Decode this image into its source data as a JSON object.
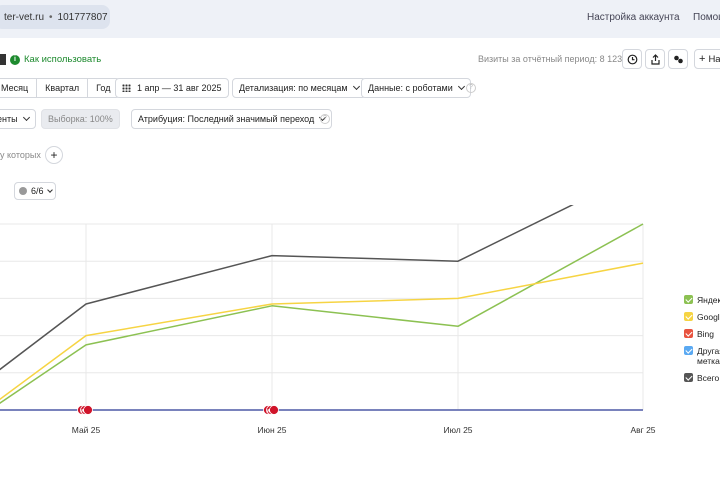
{
  "header": {
    "site": "ter-vet.ru",
    "counter_id": "101777807",
    "settings_link": "Настройка аккаунта",
    "help_link": "Помощ"
  },
  "toolbar": {
    "how_to_use": "Как использовать",
    "visits_label": "Визиты за отчётный период: 8 123",
    "add_label": "На"
  },
  "period": {
    "tabs": [
      "Месяц",
      "Квартал",
      "Год"
    ],
    "date_range": "1 апр — 31 авг 2025",
    "detail": "Детализация: по месяцам",
    "data_mode": "Данные: с роботами"
  },
  "filters": {
    "segments": "енты",
    "sample": "Выборка: 100%",
    "attribution": "Атрибуция: Последний значимый переход"
  },
  "conditions": {
    "label": "у которых"
  },
  "series_selector": {
    "label": "6/6"
  },
  "colors": {
    "yandex": "#8cc152",
    "google": "#f6d443",
    "bing": "#e8533f",
    "other": "#5aa9f2",
    "total": "#555555",
    "accent_green": "#1d8a2e"
  },
  "chart_data": {
    "type": "line",
    "categories": [
      "",
      "Май 25",
      "Июн 25",
      "Июл 25",
      "Авг 25"
    ],
    "ylim": [
      0,
      10
    ],
    "grid": true,
    "legend": "right",
    "series": [
      {
        "name": "Всего",
        "color": "#555555",
        "values": [
          2.1,
          5.7,
          8.3,
          8.0,
          12.9
        ]
      },
      {
        "name": "Яндек",
        "color": "#8cc152",
        "values": [
          0.3,
          3.5,
          5.6,
          4.5,
          10.0
        ]
      },
      {
        "name": "Google",
        "color": "#f6d443",
        "values": [
          0.5,
          4.0,
          5.7,
          6.0,
          7.9
        ]
      },
      {
        "name": "Bing",
        "color": "#e8533f",
        "values": [
          0,
          0,
          0,
          0,
          0
        ]
      },
      {
        "name": "Другая метка",
        "color": "#5aa9f2",
        "values": [
          0,
          0,
          0,
          0,
          0
        ]
      }
    ],
    "annotations": [
      {
        "x": 1,
        "label": "и"
      },
      {
        "x": 2,
        "label": "и"
      }
    ]
  },
  "legend": {
    "items": [
      {
        "label": "Яндек",
        "color": "#8cc152"
      },
      {
        "label": "Google",
        "color": "#f6d443"
      },
      {
        "label": "Bing",
        "color": "#e8533f"
      },
      {
        "label": "Другая метка",
        "label_line1": "Другая",
        "label_line2": "метка",
        "color": "#5aa9f2"
      },
      {
        "label": "Всего",
        "color": "#555555"
      }
    ]
  }
}
